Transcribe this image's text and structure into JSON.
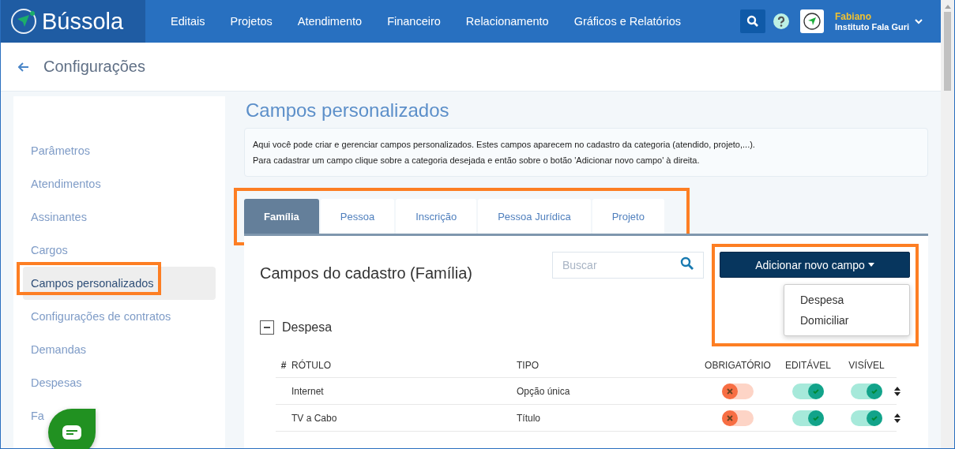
{
  "brand": "Bússola",
  "nav": [
    "Editais",
    "Projetos",
    "Atendimento",
    "Financeiro",
    "Relacionamento",
    "Gráficos e Relatórios"
  ],
  "user": {
    "name": "Fabiano",
    "org": "Instituto Fala Guri"
  },
  "page_title": "Configurações",
  "sidebar": {
    "items": [
      {
        "label": "Parâmetros",
        "selected": false,
        "highlighted": false,
        "covered": false
      },
      {
        "label": "Atendimentos",
        "selected": false,
        "highlighted": false,
        "covered": false
      },
      {
        "label": "Assinantes",
        "selected": false,
        "highlighted": false,
        "covered": false
      },
      {
        "label": "Cargos",
        "selected": false,
        "highlighted": false,
        "covered": false
      },
      {
        "label": "Campos personalizados",
        "selected": true,
        "highlighted": true,
        "covered": false
      },
      {
        "label": "Configurações de contratos",
        "selected": false,
        "highlighted": false,
        "covered": false
      },
      {
        "label": "Demandas",
        "selected": false,
        "highlighted": false,
        "covered": false
      },
      {
        "label": "Despesas",
        "selected": false,
        "highlighted": false,
        "covered": false
      },
      {
        "label": "Fa",
        "selected": false,
        "highlighted": false,
        "covered": false
      }
    ]
  },
  "section_title": "Campos personalizados",
  "info": [
    "Aqui você pode criar e gerenciar campos personalizados. Estes campos aparecem no cadastro da categoria (atendido, projeto,...).",
    "Para cadastrar um campo clique sobre a categoria desejada e então sobre o botão 'Adicionar novo campo' à direita."
  ],
  "tabs": {
    "highlighted": true,
    "items": [
      {
        "label": "Família",
        "selected": true
      },
      {
        "label": "Pessoa",
        "selected": false
      },
      {
        "label": "Inscrição",
        "selected": false
      },
      {
        "label": "Pessoa Jurídica",
        "selected": false
      },
      {
        "label": "Projeto",
        "selected": false
      }
    ]
  },
  "panel_title": "Campos do cadastro (Família)",
  "search": {
    "placeholder": "Buscar"
  },
  "add_button": {
    "label": "Adicionar novo campo",
    "highlighted": true,
    "menu": [
      "Despesa",
      "Domiciliar"
    ]
  },
  "group": {
    "title": "Despesa",
    "expanded": true,
    "columns": [
      "#",
      "RÓTULO",
      "TIPO",
      "OBRIGATÓRIO",
      "EDITÁVEL",
      "VISÍVEL"
    ],
    "rows": [
      {
        "label": "Internet",
        "type": "Opção única",
        "required": false,
        "editable": true,
        "visible": true
      },
      {
        "label": "TV a Cabo",
        "type": "Título",
        "required": false,
        "editable": true,
        "visible": true
      }
    ]
  }
}
